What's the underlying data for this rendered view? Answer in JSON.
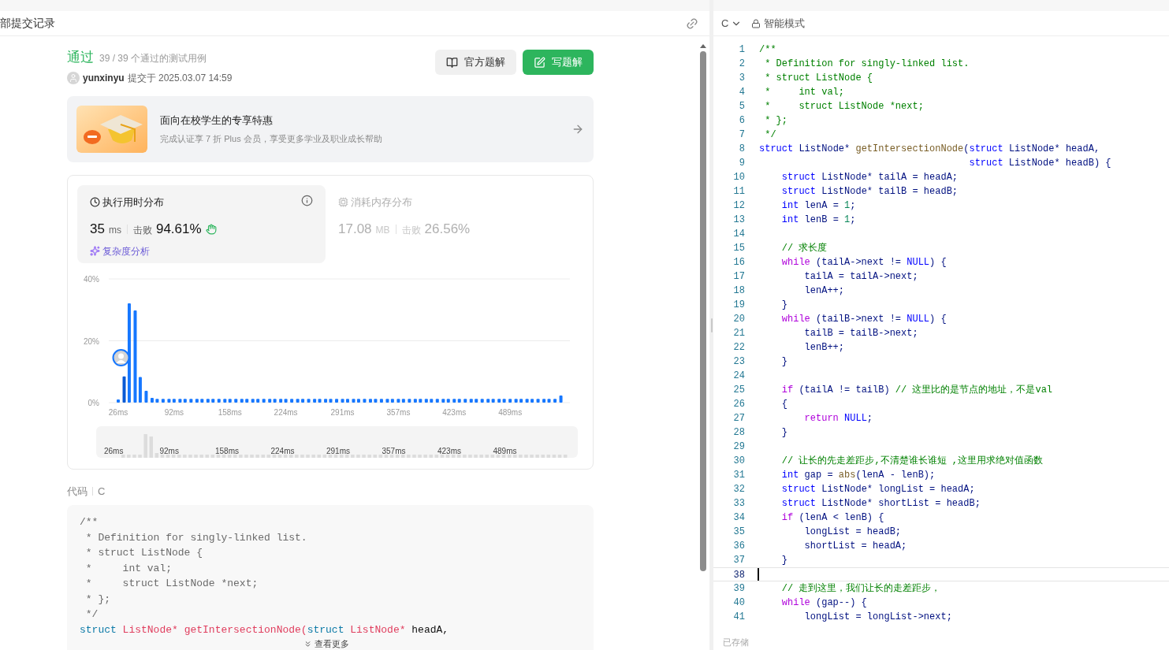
{
  "left": {
    "header": {
      "title": "部提交记录"
    },
    "result": {
      "status": "通过",
      "cases": "39 / 39 个通过的测试用例",
      "user": "yunxinyu",
      "submitted": "提交于 2025.03.07 14:59"
    },
    "buttons": [
      {
        "label": "官方题解",
        "kind": "secondary"
      },
      {
        "label": "写题解",
        "kind": "primary"
      }
    ],
    "promo": {
      "title": "面向在校学生的专享特惠",
      "subtitle": "完成认证享 7 折 Plus 会员，享受更多学业及职业成长帮助"
    },
    "stats": [
      {
        "kind": "time",
        "title": "执行用时分布",
        "value": "35",
        "unit": "ms",
        "beats_label": "击败",
        "beats": "94.61%",
        "selected": true,
        "link": "复杂度分析"
      },
      {
        "kind": "memory",
        "title": "消耗内存分布",
        "value": "17.08",
        "unit": "MB",
        "beats_label": "击败",
        "beats": "26.56%",
        "selected": false
      }
    ],
    "chart_data": {
      "type": "bar",
      "ylim": [
        0,
        40
      ],
      "yticks": [
        {
          "value": 0,
          "label": "0%"
        },
        {
          "value": 20,
          "label": "20%"
        },
        {
          "value": 40,
          "label": "40%"
        }
      ],
      "xticks": [
        {
          "value": 26,
          "label": "26ms"
        },
        {
          "value": 92,
          "label": "92ms"
        },
        {
          "value": 158,
          "label": "158ms"
        },
        {
          "value": 224,
          "label": "224ms"
        },
        {
          "value": 291,
          "label": "291ms"
        },
        {
          "value": 357,
          "label": "357ms"
        },
        {
          "value": 423,
          "label": "423ms"
        },
        {
          "value": 489,
          "label": "489ms"
        }
      ],
      "x": [
        26,
        33,
        39,
        46,
        52,
        59,
        66,
        72,
        79,
        86,
        92,
        99,
        105,
        112,
        119,
        125,
        132,
        138,
        145,
        152,
        158,
        165,
        172,
        178,
        185,
        191,
        198,
        205,
        211,
        218,
        224,
        231,
        238,
        244,
        251,
        258,
        264,
        271,
        277,
        284,
        291,
        297,
        304,
        310,
        317,
        324,
        330,
        337,
        344,
        350,
        357,
        363,
        370,
        377,
        383,
        390,
        396,
        403,
        410,
        416,
        423,
        429,
        436,
        443,
        449,
        456,
        463,
        469,
        476,
        482,
        489,
        496,
        502,
        509,
        515,
        522,
        529,
        535,
        542,
        549
      ],
      "values": [
        1.0,
        8.5,
        32.1,
        29.8,
        8.3,
        3.8,
        1.5,
        1.2,
        1.2,
        1.2,
        1.2,
        1.2,
        1.2,
        1.2,
        1.2,
        1.2,
        1.2,
        1.2,
        1.2,
        1.2,
        1.2,
        1.2,
        1.2,
        1.2,
        1.2,
        1.2,
        1.2,
        1.2,
        1.2,
        1.2,
        1.2,
        1.2,
        1.2,
        1.2,
        1.2,
        1.2,
        1.2,
        1.2,
        1.2,
        1.2,
        1.2,
        1.2,
        1.2,
        1.2,
        1.2,
        1.2,
        1.2,
        1.2,
        1.2,
        1.2,
        1.2,
        1.2,
        1.2,
        1.2,
        1.2,
        1.2,
        1.2,
        1.2,
        1.2,
        1.2,
        1.2,
        1.2,
        1.2,
        1.2,
        1.2,
        1.2,
        1.2,
        1.2,
        1.2,
        1.2,
        1.2,
        1.2,
        1.2,
        1.2,
        1.2,
        1.2,
        1.2,
        1.2,
        1.2,
        2.3
      ],
      "xlim": [
        26,
        555
      ]
    },
    "overview_labels": [
      "26ms",
      "92ms",
      "158ms",
      "224ms",
      "291ms",
      "357ms",
      "423ms",
      "489ms"
    ],
    "code_section": {
      "label": "代码",
      "language": "C",
      "more": "查看更多",
      "lines": [
        [
          {
            "kind": "comment",
            "text": "/**"
          }
        ],
        [
          {
            "kind": "comment",
            "text": " * Definition for singly-linked list."
          }
        ],
        [
          {
            "kind": "comment",
            "text": " * struct ListNode {"
          }
        ],
        [
          {
            "kind": "comment",
            "text": " *     int val;"
          }
        ],
        [
          {
            "kind": "comment",
            "text": " *     struct ListNode *next;"
          }
        ],
        [
          {
            "kind": "comment",
            "text": " * };"
          }
        ],
        [
          {
            "kind": "comment",
            "text": " */"
          }
        ],
        [
          {
            "kind": "kw",
            "text": "struct"
          },
          {
            "kind": "type",
            "text": " ListNode*"
          },
          {
            "kind": "fn",
            "text": " getIntersectionNode("
          },
          {
            "kind": "kw",
            "text": "struct"
          },
          {
            "kind": "type",
            "text": " ListNode*"
          },
          {
            "kind": "plain",
            "text": " headA,"
          }
        ]
      ]
    }
  },
  "editor": {
    "language": "C",
    "mode": "智能模式",
    "status": "已存储",
    "lines": [
      {
        "number": "1",
        "selected": false,
        "tokens": [
          {
            "kind": "comment",
            "text": "/**"
          }
        ]
      },
      {
        "number": "2",
        "selected": false,
        "tokens": [
          {
            "kind": "comment",
            "text": " * Definition for singly-linked list."
          }
        ]
      },
      {
        "number": "3",
        "selected": false,
        "tokens": [
          {
            "kind": "comment",
            "text": " * struct ListNode {"
          }
        ]
      },
      {
        "number": "4",
        "selected": false,
        "tokens": [
          {
            "kind": "comment",
            "text": " *     int val;"
          }
        ]
      },
      {
        "number": "5",
        "selected": false,
        "tokens": [
          {
            "kind": "comment",
            "text": " *     struct ListNode *next;"
          }
        ]
      },
      {
        "number": "6",
        "selected": false,
        "tokens": [
          {
            "kind": "comment",
            "text": " * };"
          }
        ]
      },
      {
        "number": "7",
        "selected": false,
        "tokens": [
          {
            "kind": "comment",
            "text": " */"
          }
        ]
      },
      {
        "number": "8",
        "selected": false,
        "tokens": [
          {
            "kind": "kw",
            "text": "struct"
          },
          {
            "kind": "plain",
            "text": " ListNode* "
          },
          {
            "kind": "fn",
            "text": "getIntersectionNode"
          },
          {
            "kind": "plain",
            "text": "("
          },
          {
            "kind": "kw",
            "text": "struct"
          },
          {
            "kind": "plain",
            "text": " ListNode* headA,"
          }
        ]
      },
      {
        "number": "9",
        "selected": false,
        "tokens": [
          {
            "kind": "kw",
            "text": "                                     struct"
          },
          {
            "kind": "plain",
            "text": " ListNode* headB) {"
          }
        ]
      },
      {
        "number": "10",
        "selected": false,
        "tokens": [
          {
            "kind": "kw",
            "text": "    struct"
          },
          {
            "kind": "plain",
            "text": " ListNode* tailA = headA;"
          }
        ]
      },
      {
        "number": "11",
        "selected": false,
        "tokens": [
          {
            "kind": "kw",
            "text": "    struct"
          },
          {
            "kind": "plain",
            "text": " ListNode* tailB = headB;"
          }
        ]
      },
      {
        "number": "12",
        "selected": false,
        "tokens": [
          {
            "kind": "kw",
            "text": "    int"
          },
          {
            "kind": "plain",
            "text": " lenA = "
          },
          {
            "kind": "num",
            "text": "1"
          },
          {
            "kind": "plain",
            "text": ";"
          }
        ]
      },
      {
        "number": "13",
        "selected": false,
        "tokens": [
          {
            "kind": "kw",
            "text": "    int"
          },
          {
            "kind": "plain",
            "text": " lenB = "
          },
          {
            "kind": "num",
            "text": "1"
          },
          {
            "kind": "plain",
            "text": ";"
          }
        ]
      },
      {
        "number": "14",
        "selected": false
      },
      {
        "number": "15",
        "selected": false,
        "tokens": [
          {
            "kind": "comment",
            "text": "    // 求长度"
          }
        ]
      },
      {
        "number": "16",
        "selected": false,
        "tokens": [
          {
            "kind": "ctrl",
            "text": "    while"
          },
          {
            "kind": "plain",
            "text": " (tailA->next != "
          },
          {
            "kind": "kw",
            "text": "NULL"
          },
          {
            "kind": "plain",
            "text": ") {"
          }
        ]
      },
      {
        "number": "17",
        "selected": false,
        "tokens": [
          {
            "kind": "plain",
            "text": "        tailA = tailA->next;"
          }
        ]
      },
      {
        "number": "18",
        "selected": false,
        "tokens": [
          {
            "kind": "plain",
            "text": "        lenA++;"
          }
        ]
      },
      {
        "number": "19",
        "selected": false,
        "tokens": [
          {
            "kind": "plain",
            "text": "    }"
          }
        ]
      },
      {
        "number": "20",
        "selected": false,
        "tokens": [
          {
            "kind": "ctrl",
            "text": "    while"
          },
          {
            "kind": "plain",
            "text": " (tailB->next != "
          },
          {
            "kind": "kw",
            "text": "NULL"
          },
          {
            "kind": "plain",
            "text": ") {"
          }
        ]
      },
      {
        "number": "21",
        "selected": false,
        "tokens": [
          {
            "kind": "plain",
            "text": "        tailB = tailB->next;"
          }
        ]
      },
      {
        "number": "22",
        "selected": false,
        "tokens": [
          {
            "kind": "plain",
            "text": "        lenB++;"
          }
        ]
      },
      {
        "number": "23",
        "selected": false,
        "tokens": [
          {
            "kind": "plain",
            "text": "    }"
          }
        ]
      },
      {
        "number": "24",
        "selected": false
      },
      {
        "number": "25",
        "selected": false,
        "tokens": [
          {
            "kind": "ctrl",
            "text": "    if"
          },
          {
            "kind": "plain",
            "text": " (tailA != tailB) "
          },
          {
            "kind": "comment",
            "text": "// 这里比的是节点的地址，不是val"
          }
        ]
      },
      {
        "number": "26",
        "selected": false,
        "tokens": [
          {
            "kind": "plain",
            "text": "    {"
          }
        ]
      },
      {
        "number": "27",
        "selected": false,
        "tokens": [
          {
            "kind": "ctrl",
            "text": "        return"
          },
          {
            "kind": "kw",
            "text": " NULL"
          },
          {
            "kind": "plain",
            "text": ";"
          }
        ]
      },
      {
        "number": "28",
        "selected": false,
        "tokens": [
          {
            "kind": "plain",
            "text": "    }"
          }
        ]
      },
      {
        "number": "29",
        "selected": false
      },
      {
        "number": "30",
        "selected": false,
        "tokens": [
          {
            "kind": "comment",
            "text": "    // 让长的先走差距步,不清楚谁长谁短 ,这里用求绝对值函数"
          }
        ]
      },
      {
        "number": "31",
        "selected": false,
        "tokens": [
          {
            "kind": "kw",
            "text": "    int"
          },
          {
            "kind": "plain",
            "text": " gap = "
          },
          {
            "kind": "fn",
            "text": "abs"
          },
          {
            "kind": "plain",
            "text": "(lenA - lenB);"
          }
        ]
      },
      {
        "number": "32",
        "selected": false,
        "tokens": [
          {
            "kind": "kw",
            "text": "    struct"
          },
          {
            "kind": "plain",
            "text": " ListNode* longList = headA;"
          }
        ]
      },
      {
        "number": "33",
        "selected": false,
        "tokens": [
          {
            "kind": "kw",
            "text": "    struct"
          },
          {
            "kind": "plain",
            "text": " ListNode* shortList = headB;"
          }
        ]
      },
      {
        "number": "34",
        "selected": false,
        "tokens": [
          {
            "kind": "ctrl",
            "text": "    if"
          },
          {
            "kind": "plain",
            "text": " (lenA < lenB) {"
          }
        ]
      },
      {
        "number": "35",
        "selected": false,
        "tokens": [
          {
            "kind": "plain",
            "text": "        longList = headB;"
          }
        ]
      },
      {
        "number": "36",
        "selected": false,
        "tokens": [
          {
            "kind": "plain",
            "text": "        shortList = headA;"
          }
        ]
      },
      {
        "number": "37",
        "selected": false,
        "tokens": [
          {
            "kind": "plain",
            "text": "    }"
          }
        ]
      },
      {
        "number": "38",
        "selected": true
      },
      {
        "number": "39",
        "selected": false,
        "tokens": [
          {
            "kind": "comment",
            "text": "    // 走到这里，我们让长的走差距步，"
          }
        ]
      },
      {
        "number": "40",
        "selected": false,
        "tokens": [
          {
            "kind": "ctrl",
            "text": "    while"
          },
          {
            "kind": "plain",
            "text": " (gap--) {"
          }
        ]
      },
      {
        "number": "41",
        "selected": false,
        "tokens": [
          {
            "kind": "plain",
            "text": "        longList = longList->next;"
          }
        ]
      }
    ]
  }
}
